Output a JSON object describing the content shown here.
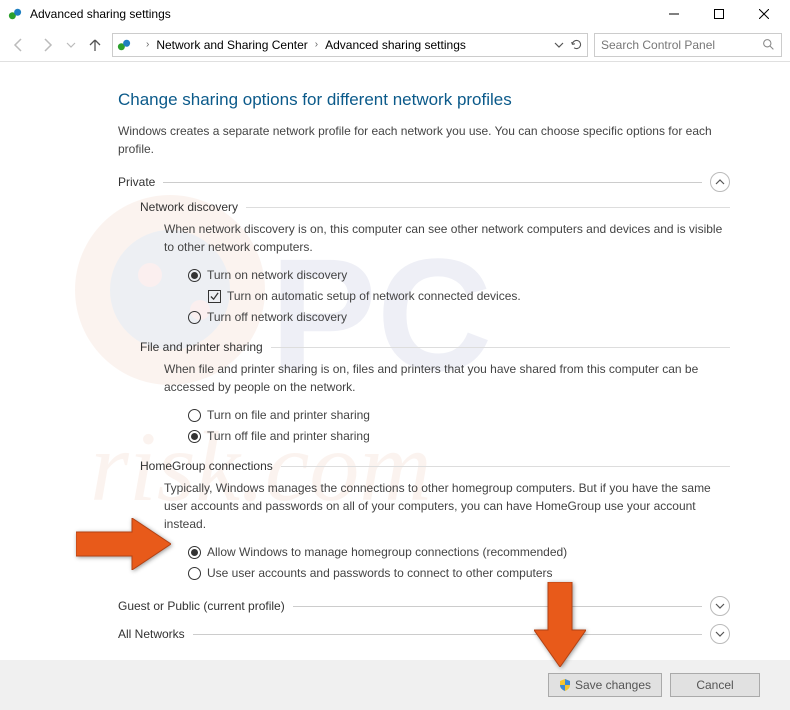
{
  "window": {
    "title": "Advanced sharing settings"
  },
  "breadcrumb": {
    "item1": "Network and Sharing Center",
    "item2": "Advanced sharing settings"
  },
  "search": {
    "placeholder": "Search Control Panel"
  },
  "page": {
    "heading": "Change sharing options for different network profiles",
    "intro": "Windows creates a separate network profile for each network you use. You can choose specific options for each profile."
  },
  "profiles": {
    "private": {
      "label": "Private"
    },
    "guest": {
      "label": "Guest or Public (current profile)"
    },
    "all": {
      "label": "All Networks"
    }
  },
  "network_discovery": {
    "title": "Network discovery",
    "desc": "When network discovery is on, this computer can see other network computers and devices and is visible to other network computers.",
    "opt_on": "Turn on network discovery",
    "opt_auto": "Turn on automatic setup of network connected devices.",
    "opt_off": "Turn off network discovery"
  },
  "file_printer": {
    "title": "File and printer sharing",
    "desc": "When file and printer sharing is on, files and printers that you have shared from this computer can be accessed by people on the network.",
    "opt_on": "Turn on file and printer sharing",
    "opt_off": "Turn off file and printer sharing"
  },
  "homegroup": {
    "title": "HomeGroup connections",
    "desc": "Typically, Windows manages the connections to other homegroup computers. But if you have the same user accounts and passwords on all of your computers, you can have HomeGroup use your account instead.",
    "opt_allow": "Allow Windows to manage homegroup connections (recommended)",
    "opt_user": "Use user accounts and passwords to connect to other computers"
  },
  "footer": {
    "save": "Save changes",
    "cancel": "Cancel"
  }
}
